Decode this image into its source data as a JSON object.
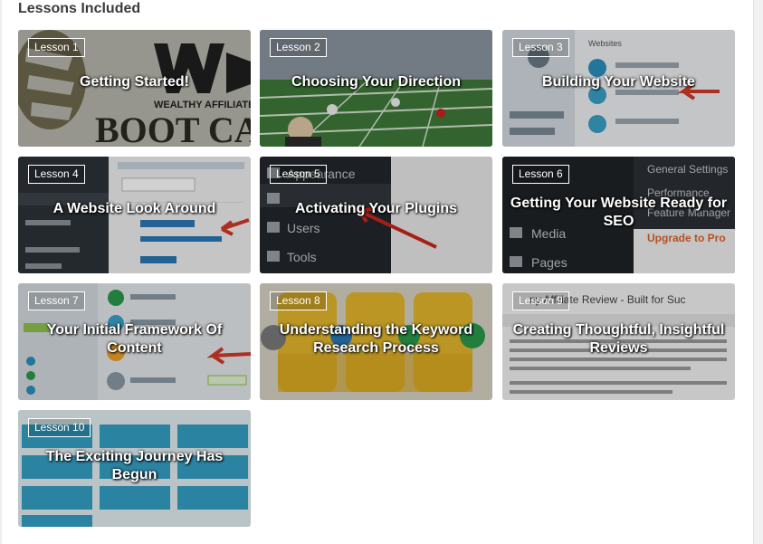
{
  "section": {
    "title": "Lessons Included"
  },
  "lessons": [
    {
      "badge": "Lesson 1",
      "title": "Getting Started!",
      "thumb_icon": "boot-camp-logo-image",
      "bg": "#9a9a94"
    },
    {
      "badge": "Lesson 2",
      "title": "Choosing Your Direction",
      "thumb_icon": "football-stadium-image",
      "bg": "#3f6b3c"
    },
    {
      "badge": "Lesson 3",
      "title": "Building Your Website",
      "thumb_icon": "websites-dashboard-image",
      "bg": "#c9d3dc"
    },
    {
      "badge": "Lesson 4",
      "title": "A Website Look Around",
      "thumb_icon": "wordpress-pages-screen-image",
      "bg": "#2c3338"
    },
    {
      "badge": "Lesson 5",
      "title": "Activating Your Plugins",
      "thumb_icon": "wordpress-plugins-menu-image",
      "bg": "#23282d"
    },
    {
      "badge": "Lesson 6",
      "title": "Getting Your Website Ready for SEO",
      "thumb_icon": "seo-settings-menu-image",
      "bg": "#1f2326"
    },
    {
      "badge": "Lesson 7",
      "title": "Your Initial Framework Of Content",
      "thumb_icon": "site-builder-menu-image",
      "bg": "#c7d2d9"
    },
    {
      "badge": "Lesson 8",
      "title": "Understanding the Keyword Research Process",
      "thumb_icon": "keyword-research-flow-image",
      "bg": "#c9a83a"
    },
    {
      "badge": "Lesson 9",
      "title": "Creating Thoughtful, Insightful Reviews",
      "thumb_icon": "review-editor-image",
      "bg": "#d8d8d8"
    },
    {
      "badge": "Lesson 10",
      "title": "The Exciting Journey Has Begun",
      "thumb_icon": "course-lessons-grid-image",
      "bg": "#5aa9c8"
    }
  ]
}
